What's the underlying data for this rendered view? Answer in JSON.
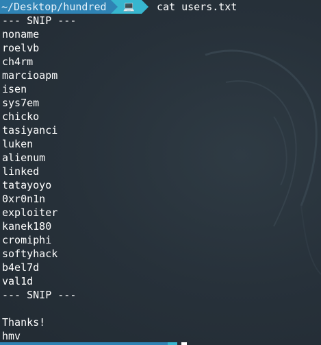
{
  "prompt": {
    "path": "~/Desktop/hundred",
    "icon": "terminal-icon",
    "icon_glyph": "💻",
    "command": "cat users.txt"
  },
  "output": {
    "lines": [
      "--- SNIP ---",
      "noname",
      "roelvb",
      "ch4rm",
      "marcioapm",
      "isen",
      "sys7em",
      "chicko",
      "tasiyanci",
      "luken",
      "alienum",
      "linked",
      "tatayoyo",
      "0xr0n1n",
      "exploiter",
      "kanek180",
      "cromiphi",
      "softyhack",
      "b4el7d",
      "val1d",
      "--- SNIP ---",
      "",
      "Thanks!",
      "hmv"
    ]
  },
  "colors": {
    "background": "#263038",
    "path_segment": "#2f83b4",
    "icon_segment": "#37b6cf",
    "text": "#ffffff"
  }
}
